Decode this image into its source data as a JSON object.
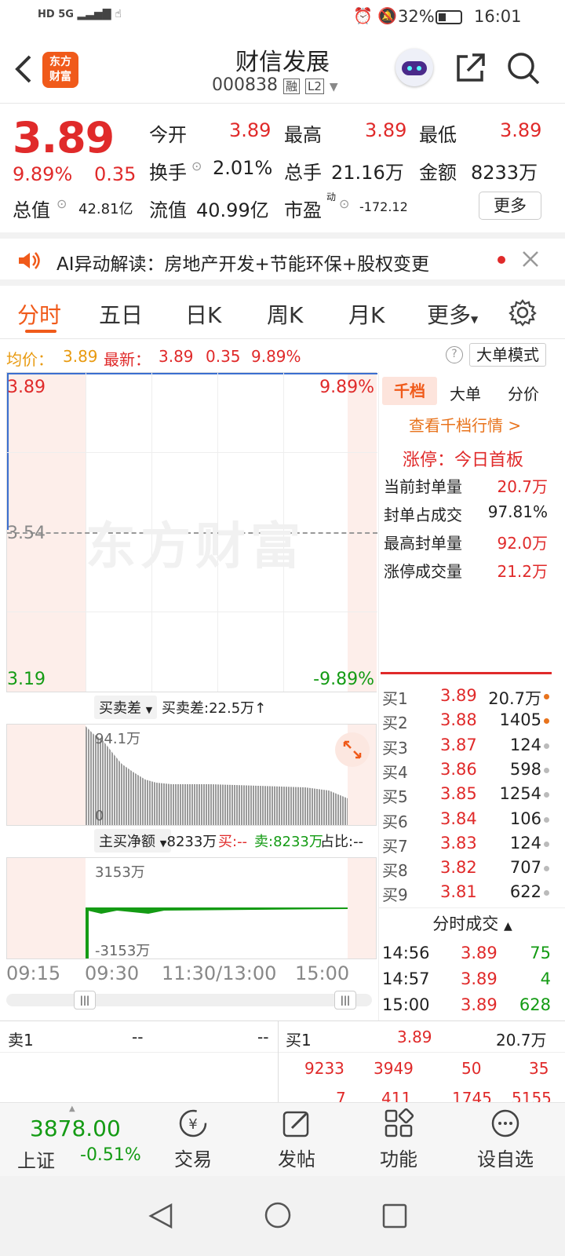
{
  "status": {
    "left": "HD 5G",
    "battery": "32%",
    "time": "16:01"
  },
  "header": {
    "logo": "东方\n财富",
    "title": "财信发展",
    "code": "000838",
    "tag1": "融",
    "tag2": "L2"
  },
  "quote": {
    "price": "3.89",
    "pct": "9.89%",
    "chg": "0.35",
    "open_label": "今开",
    "open": "3.89",
    "high_label": "最高",
    "high": "3.89",
    "low_label": "最低",
    "low": "3.89",
    "turnover_label": "换手",
    "turnover": "2.01%",
    "vol_label": "总手",
    "vol": "21.16万",
    "amt_label": "金额",
    "amt": "8233万",
    "mcap_label": "总值",
    "mcap": "42.81亿",
    "float_label": "流值",
    "float": "40.99亿",
    "pe_label": "市盈",
    "pe_sup": "动",
    "pe": "-172.12",
    "more_btn": "更多"
  },
  "ai_banner": {
    "text": "AI异动解读：房地产开发+节能环保+股权变更"
  },
  "tabs": [
    "分时",
    "五日",
    "日K",
    "周K",
    "月K",
    "更多"
  ],
  "info_bar": {
    "avg_label": "均价：",
    "avg": "3.89",
    "latest_label": "最新：",
    "latest": "3.89",
    "chg": "0.35",
    "pct": "9.89%",
    "mode_btn": "大单模式"
  },
  "chart": {
    "y_top": "3.89",
    "y_mid": "3.54",
    "y_bot": "3.19",
    "pct_top": "9.89%",
    "pct_bot": "-9.89%",
    "watermark": "东方财富",
    "vol_dropdown": "买卖差",
    "vol_info": "买卖差:22.5万↑",
    "vol_max": "94.1万",
    "vol_zero": "0",
    "flow_dropdown": "主买净额",
    "flow_value": "-8233万",
    "flow_buy": "买:--",
    "flow_sell": "卖:8233万",
    "flow_ratio": "占比:--",
    "flow_max": "3153万",
    "flow_min": "-3153万",
    "times": [
      "09:15",
      "09:30",
      "11:30/13:00",
      "15:00"
    ]
  },
  "right_panel": {
    "tabs": [
      "千档",
      "大单",
      "分价"
    ],
    "link": "查看千档行情 >",
    "limit_title": "涨停：今日首板",
    "limit_rows": [
      {
        "label": "当前封单量",
        "value": "20.7万"
      },
      {
        "label": "封单占成交",
        "value": "97.81%"
      },
      {
        "label": "最高封单量",
        "value": "92.0万"
      },
      {
        "label": "涨停成交量",
        "value": "21.2万"
      }
    ],
    "bids": [
      {
        "label": "买1",
        "price": "3.89",
        "vol": "20.7万"
      },
      {
        "label": "买2",
        "price": "3.88",
        "vol": "1405"
      },
      {
        "label": "买3",
        "price": "3.87",
        "vol": "124"
      },
      {
        "label": "买4",
        "price": "3.86",
        "vol": "598"
      },
      {
        "label": "买5",
        "price": "3.85",
        "vol": "1254"
      },
      {
        "label": "买6",
        "price": "3.84",
        "vol": "106"
      },
      {
        "label": "买7",
        "price": "3.83",
        "vol": "124"
      },
      {
        "label": "买8",
        "price": "3.82",
        "vol": "707"
      },
      {
        "label": "买9",
        "price": "3.81",
        "vol": "622"
      }
    ],
    "trades_title": "分时成交",
    "trades": [
      {
        "time": "14:56",
        "price": "3.89",
        "vol": "75"
      },
      {
        "time": "14:57",
        "price": "3.89",
        "vol": "4"
      },
      {
        "time": "15:00",
        "price": "3.89",
        "vol": "628"
      }
    ]
  },
  "orderbar": {
    "sell_label": "卖1",
    "sell_price": "--",
    "sell_vol": "--",
    "buy_label": "买1",
    "buy_price": "3.89",
    "buy_vol": "20.7万",
    "row1": [
      "9233",
      "3949",
      "50",
      "35"
    ],
    "row2": [
      "7",
      "411",
      "1745",
      "5155"
    ]
  },
  "bottom_nav": {
    "index_value": "3878.00",
    "index_name": "上证",
    "index_pct": "-0.51%",
    "items": [
      "交易",
      "发帖",
      "功能",
      "设自选"
    ]
  },
  "colors": {
    "red": "#e02a2a",
    "green": "#149b14",
    "brand": "#f05a1a"
  }
}
